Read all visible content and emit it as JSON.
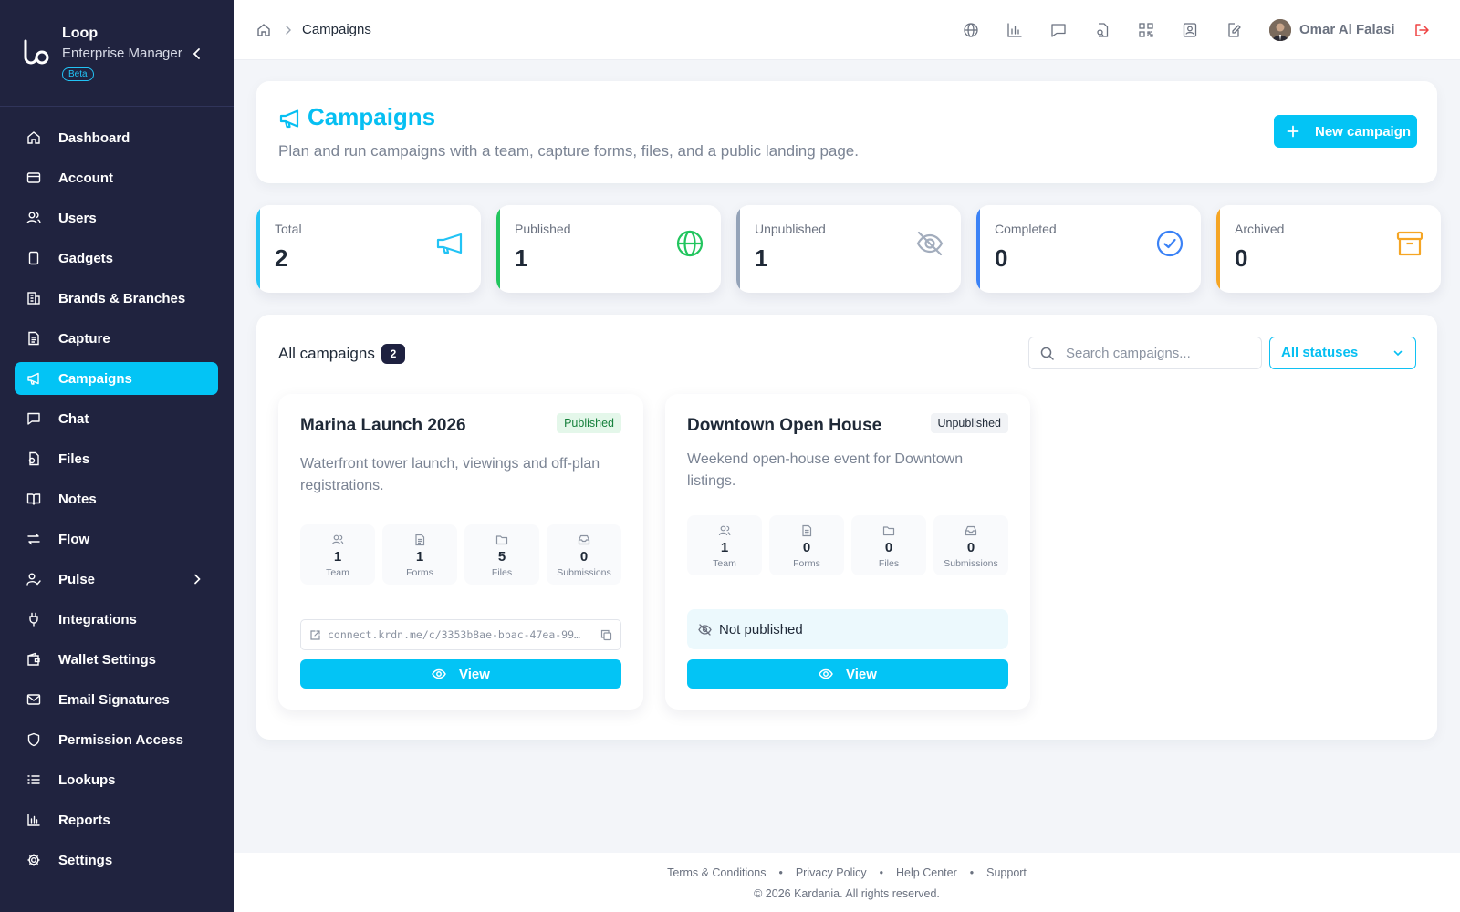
{
  "brand": {
    "name": "Loop",
    "subtitle": "Enterprise Manager",
    "badge": "Beta"
  },
  "sidebar": {
    "items": [
      {
        "label": "Dashboard",
        "icon": "home-icon"
      },
      {
        "label": "Account",
        "icon": "card-icon"
      },
      {
        "label": "Users",
        "icon": "users-icon"
      },
      {
        "label": "Gadgets",
        "icon": "device-icon"
      },
      {
        "label": "Brands & Branches",
        "icon": "building-icon"
      },
      {
        "label": "Capture",
        "icon": "document-icon"
      },
      {
        "label": "Campaigns",
        "icon": "megaphone-icon",
        "active": true
      },
      {
        "label": "Chat",
        "icon": "chat-icon"
      },
      {
        "label": "Files",
        "icon": "file-icon"
      },
      {
        "label": "Notes",
        "icon": "book-icon"
      },
      {
        "label": "Flow",
        "icon": "flow-icon"
      },
      {
        "label": "Pulse",
        "icon": "pulse-icon",
        "expandable": true
      },
      {
        "label": "Integrations",
        "icon": "plug-icon"
      },
      {
        "label": "Wallet Settings",
        "icon": "wallet-icon"
      },
      {
        "label": "Email Signatures",
        "icon": "mail-icon"
      },
      {
        "label": "Permission Access",
        "icon": "shield-icon"
      },
      {
        "label": "Lookups",
        "icon": "list-icon"
      },
      {
        "label": "Reports",
        "icon": "bar-chart-icon"
      },
      {
        "label": "Settings",
        "icon": "gear-icon"
      }
    ]
  },
  "topbar": {
    "breadcrumb": "Campaigns",
    "user_name": "Omar Al Falasi",
    "icons": [
      "globe-icon",
      "bar-chart-icon",
      "chat-icon",
      "file-search-icon",
      "qr-icon",
      "contact-icon",
      "edit-icon"
    ]
  },
  "header": {
    "title": "Campaigns",
    "description": "Plan and run campaigns with a team, capture forms, files, and a public landing page.",
    "new_button": "New campaign"
  },
  "stats": [
    {
      "label": "Total",
      "value": "2",
      "color": "#22c3f5",
      "icon": "megaphone-icon"
    },
    {
      "label": "Published",
      "value": "1",
      "color": "#22c55e",
      "icon": "globe-icon"
    },
    {
      "label": "Unpublished",
      "value": "1",
      "color": "#94a3b8",
      "icon": "eye-off-icon"
    },
    {
      "label": "Completed",
      "value": "0",
      "color": "#3b82f6",
      "icon": "check-circle-icon"
    },
    {
      "label": "Archived",
      "value": "0",
      "color": "#f5a524",
      "icon": "archive-icon"
    }
  ],
  "panel": {
    "title": "All campaigns",
    "count": "2",
    "search_placeholder": "Search campaigns...",
    "status_filter": "All statuses"
  },
  "campaigns": [
    {
      "title": "Marina Launch 2026",
      "status": "Published",
      "description": "Waterfront tower launch, viewings and off-plan registrations.",
      "metrics": [
        {
          "value": "1",
          "label": "Team"
        },
        {
          "value": "1",
          "label": "Forms"
        },
        {
          "value": "5",
          "label": "Files"
        },
        {
          "value": "0",
          "label": "Submissions"
        }
      ],
      "link": "connect.krdn.me/c/3353b8ae-bbac-47ea-99…",
      "view_label": "View"
    },
    {
      "title": "Downtown Open House",
      "status": "Unpublished",
      "description": "Weekend open-house event for Downtown listings.",
      "metrics": [
        {
          "value": "1",
          "label": "Team"
        },
        {
          "value": "0",
          "label": "Forms"
        },
        {
          "value": "0",
          "label": "Files"
        },
        {
          "value": "0",
          "label": "Submissions"
        }
      ],
      "not_published_label": "Not published",
      "view_label": "View"
    }
  ],
  "footer": {
    "links": [
      "Terms & Conditions",
      "Privacy Policy",
      "Help Center",
      "Support"
    ],
    "copyright": "© 2026 Kardania. All rights reserved."
  },
  "colors": {
    "accent": "#03c4f5",
    "sidebar_bg": "#20233f"
  }
}
